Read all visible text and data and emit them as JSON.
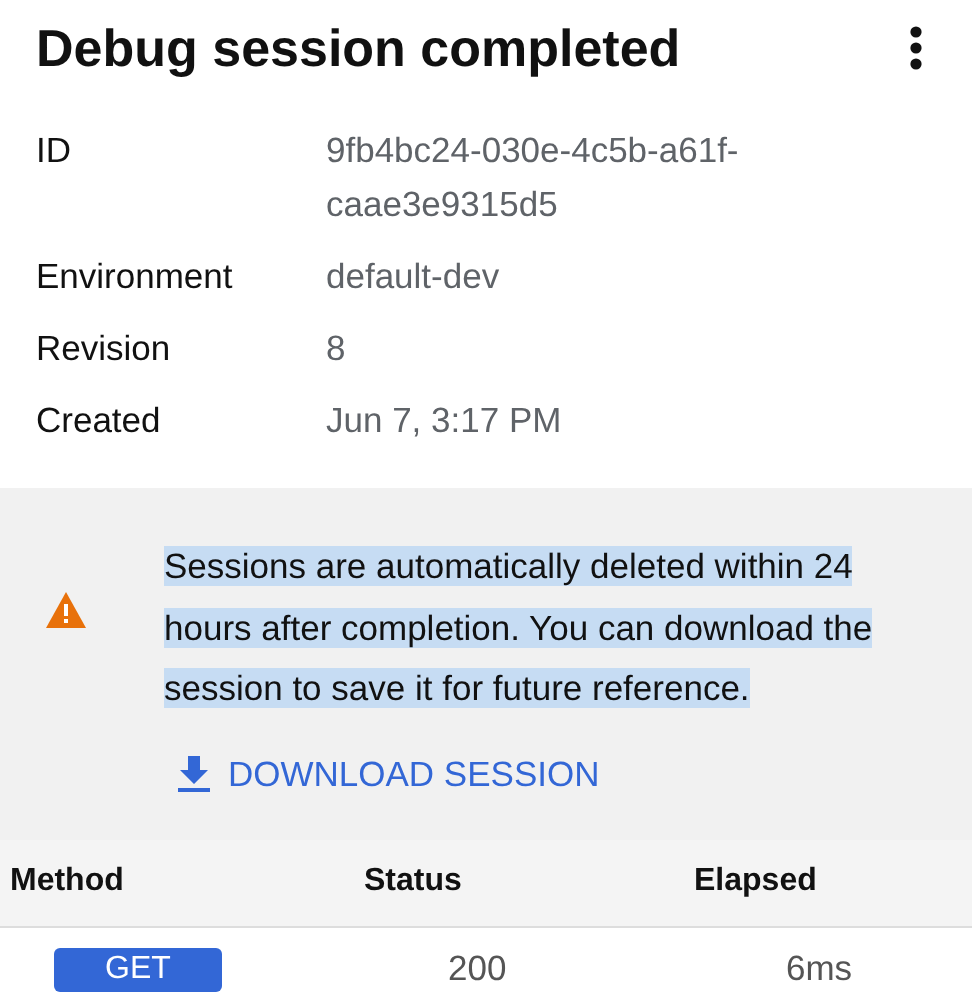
{
  "title": "Debug session completed",
  "details": [
    {
      "label": "ID",
      "value": "9fb4bc24-030e-4c5b-a61f-caae3e9315d5"
    },
    {
      "label": "Environment",
      "value": "default-dev"
    },
    {
      "label": "Revision",
      "value": "8"
    },
    {
      "label": "Created",
      "value": "Jun 7, 3:17 PM"
    }
  ],
  "notice": {
    "text": "Sessions are automatically deleted within 24 hours after completion. You can download the session to save it for future reference.",
    "highlighted": true,
    "action": "DOWNLOAD SESSION"
  },
  "table": {
    "columns": [
      "Method",
      "Status",
      "Elapsed"
    ],
    "rows": [
      {
        "method": "GET",
        "status": "200",
        "elapsed": "6ms"
      }
    ]
  }
}
